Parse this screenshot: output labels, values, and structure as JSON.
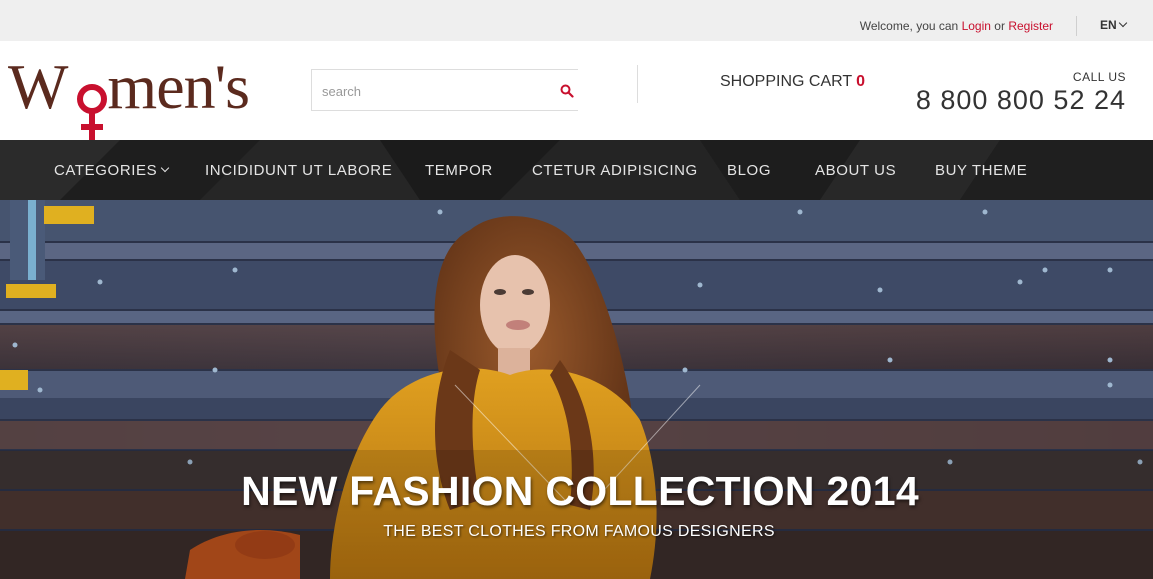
{
  "topbar": {
    "welcome_text": "Welcome, you can",
    "login_label": "Login",
    "or_text": "or",
    "register_label": "Register",
    "language": "EN"
  },
  "header": {
    "logo_text_before": "W",
    "logo_text_after": "men's",
    "search_placeholder": "search",
    "cart_label": "SHOPPING CART",
    "cart_count": "0",
    "call_label": "CALL US",
    "phone": "8 800 800 52 24"
  },
  "nav": {
    "items": [
      {
        "label": "CATEGORIES"
      },
      {
        "label": "INCIDIDUNT UT LABORE"
      },
      {
        "label": "TEMPOR"
      },
      {
        "label": "CTETUR ADIPISICING"
      },
      {
        "label": "BLOG"
      },
      {
        "label": "ABOUT US"
      },
      {
        "label": "BUY THEME"
      }
    ]
  },
  "hero": {
    "headline": "NEW FASHION COLLECTION 2014",
    "subline": "THE BEST CLOTHES FROM FAMOUS DESIGNERS"
  },
  "colors": {
    "accent": "#c8102e",
    "logo": "#5b2a1e",
    "nav_bg": "#222222",
    "topbar_bg": "#efefef"
  }
}
